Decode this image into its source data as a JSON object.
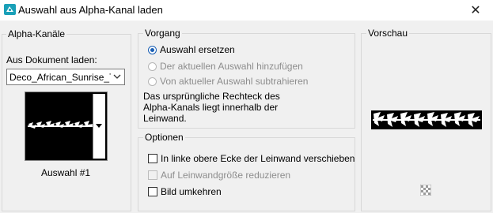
{
  "window": {
    "title": "Auswahl aus Alpha-Kanal laden",
    "close_symbol": "✕",
    "app_icon": "psp-app-icon"
  },
  "alpha_channels": {
    "group_title": "Alpha-Kanäle",
    "from_document_label": "Aus Dokument laden:",
    "document_value": "Deco_African_Sunrise_Ts",
    "selection_name": "Auswahl #1"
  },
  "vorgang": {
    "group_title": "Vorgang",
    "options": [
      {
        "label": "Auswahl ersetzen",
        "checked": true,
        "enabled": true
      },
      {
        "label": "Der aktuellen Auswahl hinzufügen",
        "checked": false,
        "enabled": false
      },
      {
        "label": "Von aktueller Auswahl subtrahieren",
        "checked": false,
        "enabled": false
      }
    ],
    "note_line1": "Das ursprüngliche Rechteck des",
    "note_line2": "Alpha-Kanals liegt innerhalb der",
    "note_line3": "Leinwand."
  },
  "optionen": {
    "group_title": "Optionen",
    "checks": [
      {
        "label": "In linke obere Ecke der Leinwand verschieben",
        "checked": false,
        "enabled": true
      },
      {
        "label": "Auf Leinwandgröße reduzieren",
        "checked": false,
        "enabled": false
      },
      {
        "label": "Bild umkehren",
        "checked": false,
        "enabled": true
      }
    ]
  },
  "vorschau": {
    "group_title": "Vorschau",
    "transparency_icon": "checkerboard-icon"
  },
  "colors": {
    "accent": "#1a5fb4",
    "app_icon": "#1aa0b8"
  }
}
